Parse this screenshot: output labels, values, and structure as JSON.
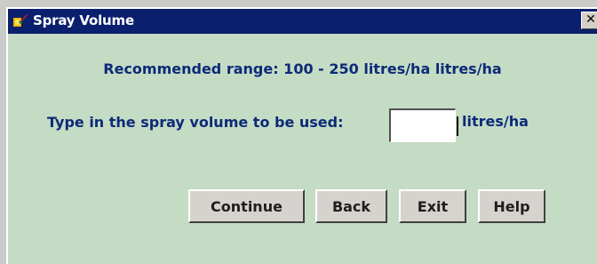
{
  "window": {
    "title": "Spray Volume",
    "close_label": "✕",
    "app_icon": "paint-brush-icon"
  },
  "range_text": "Recommended range: 100 - 250 litres/ha litres/ha",
  "prompt": "Type in the spray volume to be used:",
  "volume_input": {
    "value": "",
    "placeholder": ""
  },
  "unit": "litres/ha",
  "buttons": {
    "continue": "Continue",
    "back": "Back",
    "exit": "Exit",
    "help": "Help"
  },
  "colors": {
    "titlebar": "#0a1f6d",
    "background": "#c4dcc4",
    "text": "#0d2a78"
  }
}
